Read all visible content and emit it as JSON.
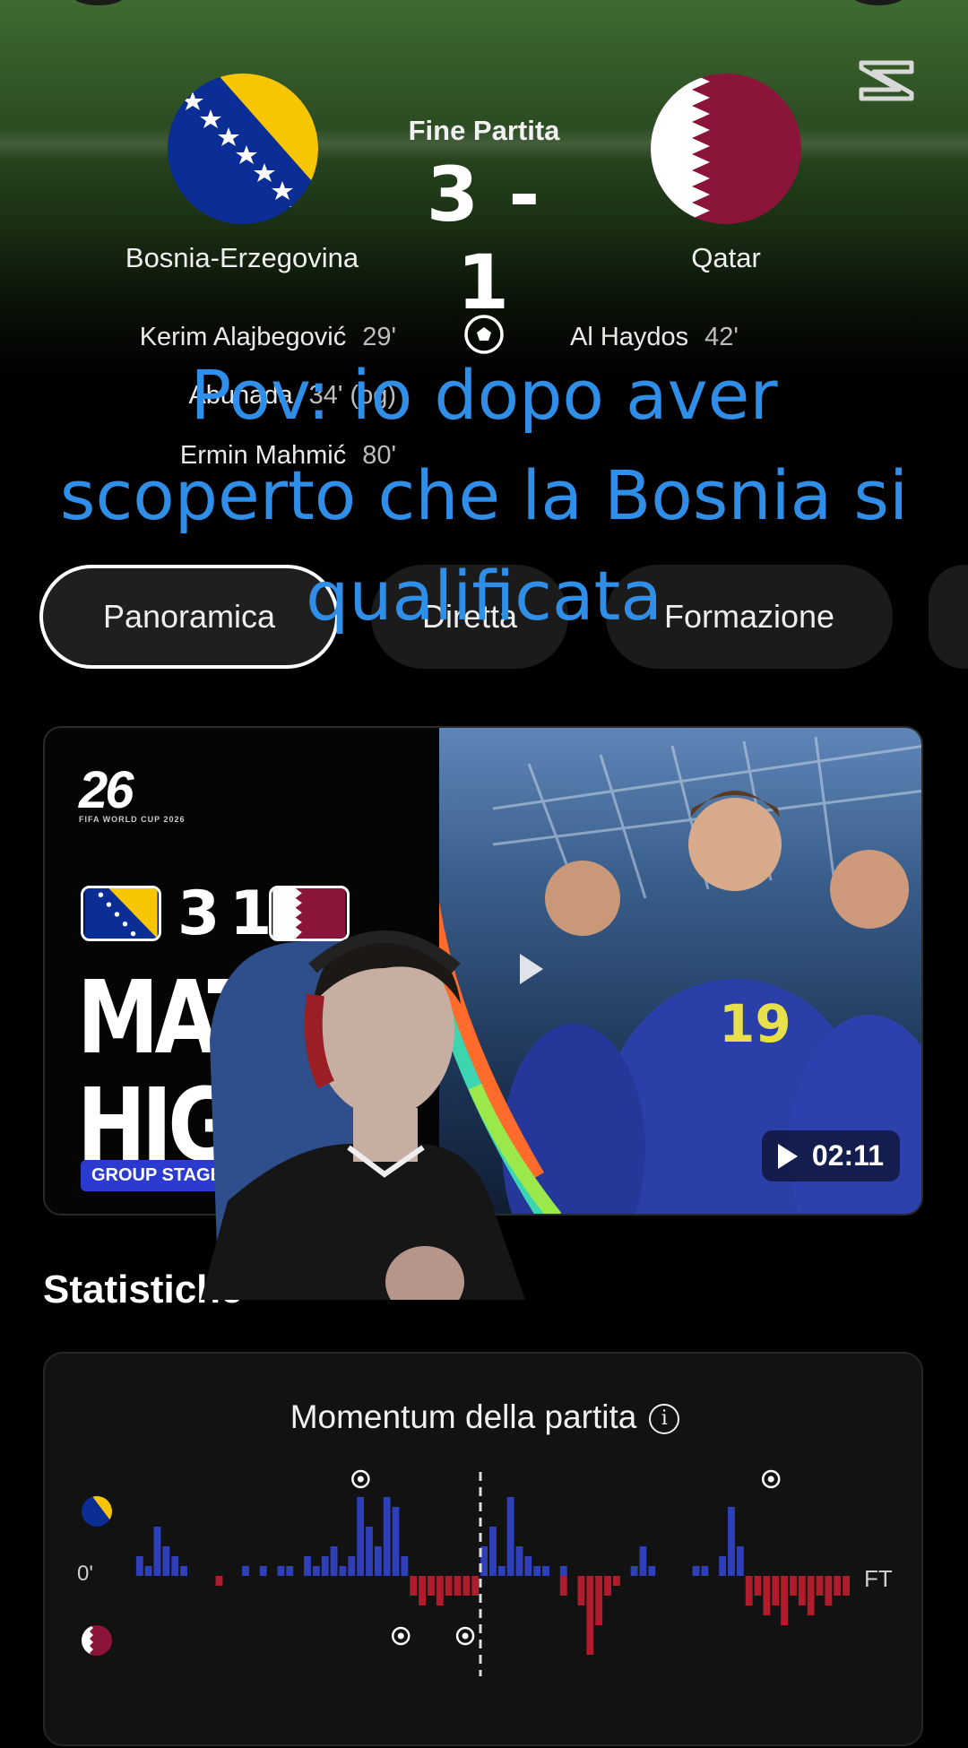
{
  "match": {
    "status": "Fine Partita",
    "score": "3 - 1",
    "home": {
      "name": "Bosnia-Erzegovina"
    },
    "away": {
      "name": "Qatar"
    }
  },
  "scorers": {
    "home": [
      {
        "name": "Kerim Alajbegović",
        "minute": "29'"
      },
      {
        "name": "Abunada",
        "minute": "34' (og)"
      },
      {
        "name": "Ermin Mahmić",
        "minute": "80'"
      }
    ],
    "away": [
      {
        "name": "Al Haydos",
        "minute": "42'"
      }
    ]
  },
  "overlay_caption": "Pov: io dopo aver scoperto che la Bosnia si qualificata",
  "tabs": [
    {
      "label": "Panoramica",
      "active": true
    },
    {
      "label": "Diretta",
      "active": false
    },
    {
      "label": "Formazione",
      "active": false
    }
  ],
  "video": {
    "thumb_score_home": "3",
    "thumb_score_away": "1",
    "thumb_title_1": "MATC",
    "thumb_title_2": "HIGH",
    "thumb_badge": "GROUP STAGE",
    "thumb_logo": "26",
    "thumb_logo_sub": "FIFA WORLD CUP 2026",
    "thumb_jersey": "19",
    "duration": "02:11"
  },
  "stats": {
    "section_title": "Statistiche",
    "momentum_title": "Momentum della partita",
    "start_label": "0'",
    "end_label": "FT"
  },
  "colors": {
    "overlay_text": "#2f8fe8",
    "home_bar": "#2f3fb8",
    "away_bar": "#b01c2b",
    "bosnia_blue": "#0a2d96",
    "bosnia_yellow": "#f7c600",
    "qatar_maroon": "#8a1538"
  },
  "chart_data": {
    "type": "bar",
    "title": "Momentum della partita",
    "x_range": [
      0,
      90
    ],
    "home_goal_minutes": [
      29,
      80
    ],
    "away_goal_minutes": [
      34,
      42
    ],
    "home_values": [
      0,
      2,
      1,
      5,
      3,
      2,
      1,
      0,
      0,
      0,
      0,
      0,
      0,
      1,
      0,
      1,
      0,
      1,
      1,
      0,
      2,
      1,
      2,
      3,
      1,
      2,
      8,
      5,
      3,
      8,
      7,
      2,
      0,
      0,
      0,
      0,
      0,
      0,
      0,
      0,
      3,
      5,
      1,
      8,
      3,
      2,
      1,
      1,
      0,
      1,
      0,
      0,
      0,
      0,
      0,
      0,
      0,
      1,
      3,
      1,
      0,
      0,
      0,
      0,
      1,
      1,
      0,
      2,
      7,
      3,
      0,
      0,
      0,
      0,
      0,
      0,
      0,
      0,
      0,
      0,
      0,
      0
    ],
    "away_values": [
      0,
      0,
      0,
      0,
      0,
      0,
      0,
      0,
      0,
      0,
      1,
      0,
      0,
      0,
      0,
      0,
      0,
      0,
      0,
      0,
      0,
      0,
      0,
      0,
      0,
      0,
      0,
      0,
      0,
      0,
      0,
      0,
      2,
      3,
      2,
      3,
      2,
      2,
      2,
      2,
      0,
      0,
      0,
      0,
      0,
      0,
      0,
      0,
      0,
      2,
      0,
      3,
      8,
      5,
      2,
      1,
      0,
      0,
      0,
      0,
      0,
      0,
      0,
      0,
      0,
      0,
      0,
      0,
      0,
      0,
      3,
      2,
      4,
      3,
      5,
      2,
      3,
      4,
      2,
      3,
      2,
      2
    ]
  }
}
